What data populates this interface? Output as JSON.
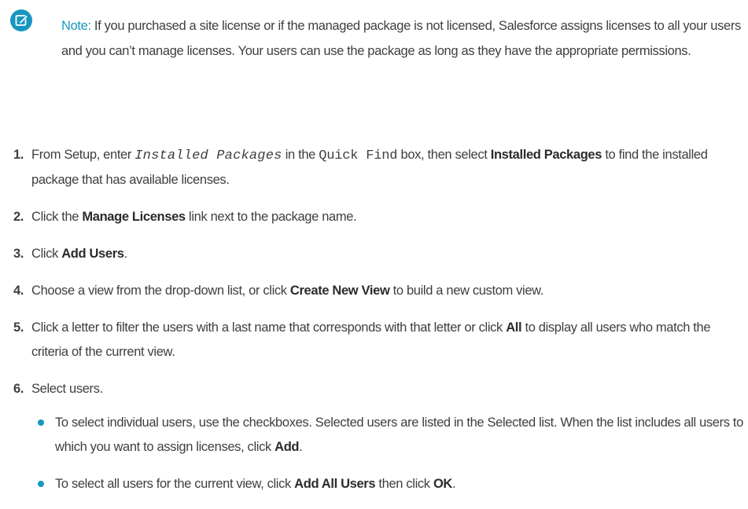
{
  "note": {
    "icon": "edit-note-icon",
    "accent_color": "#1797c0",
    "label": "Note:",
    "text": "If you purchased a site license or if the managed package is not licensed, Salesforce assigns licenses to all your users and you can’t manage licenses. Your users can use the package as long as they have the appropriate permissions."
  },
  "steps": [
    {
      "number": "1.",
      "parts": {
        "t1": "From Setup, enter ",
        "code1": "Installed Packages",
        "t2": " in the ",
        "code2": "Quick Find",
        "t3": " box, then select ",
        "b1": "Installed Packages",
        "t4": " to find the installed package that has available licenses."
      }
    },
    {
      "number": "2.",
      "parts": {
        "t1": "Click the ",
        "b1": "Manage Licenses",
        "t2": " link next to the package name."
      }
    },
    {
      "number": "3.",
      "parts": {
        "t1": "Click ",
        "b1": "Add Users",
        "t2": "."
      }
    },
    {
      "number": "4.",
      "parts": {
        "t1": "Choose a view from the drop-down list, or click ",
        "b1": "Create New View",
        "t2": " to build a new custom view."
      }
    },
    {
      "number": "5.",
      "parts": {
        "t1": "Click a letter to filter the users with a last name that corresponds with that letter or click ",
        "b1": "All",
        "t2": " to display all users who match the criteria of the current view."
      }
    },
    {
      "number": "6.",
      "parts": {
        "t1": "Select users."
      },
      "bullets": [
        {
          "t1": "To select individual users, use the checkboxes. Selected users are listed in the Selected list. When the list includes all users to which you want to assign licenses, click ",
          "b1": "Add",
          "t2": "."
        },
        {
          "t1": "To select all users for the current view, click ",
          "b1": "Add All Users",
          "t2": " then click ",
          "b2": "OK",
          "t3": "."
        }
      ]
    }
  ]
}
